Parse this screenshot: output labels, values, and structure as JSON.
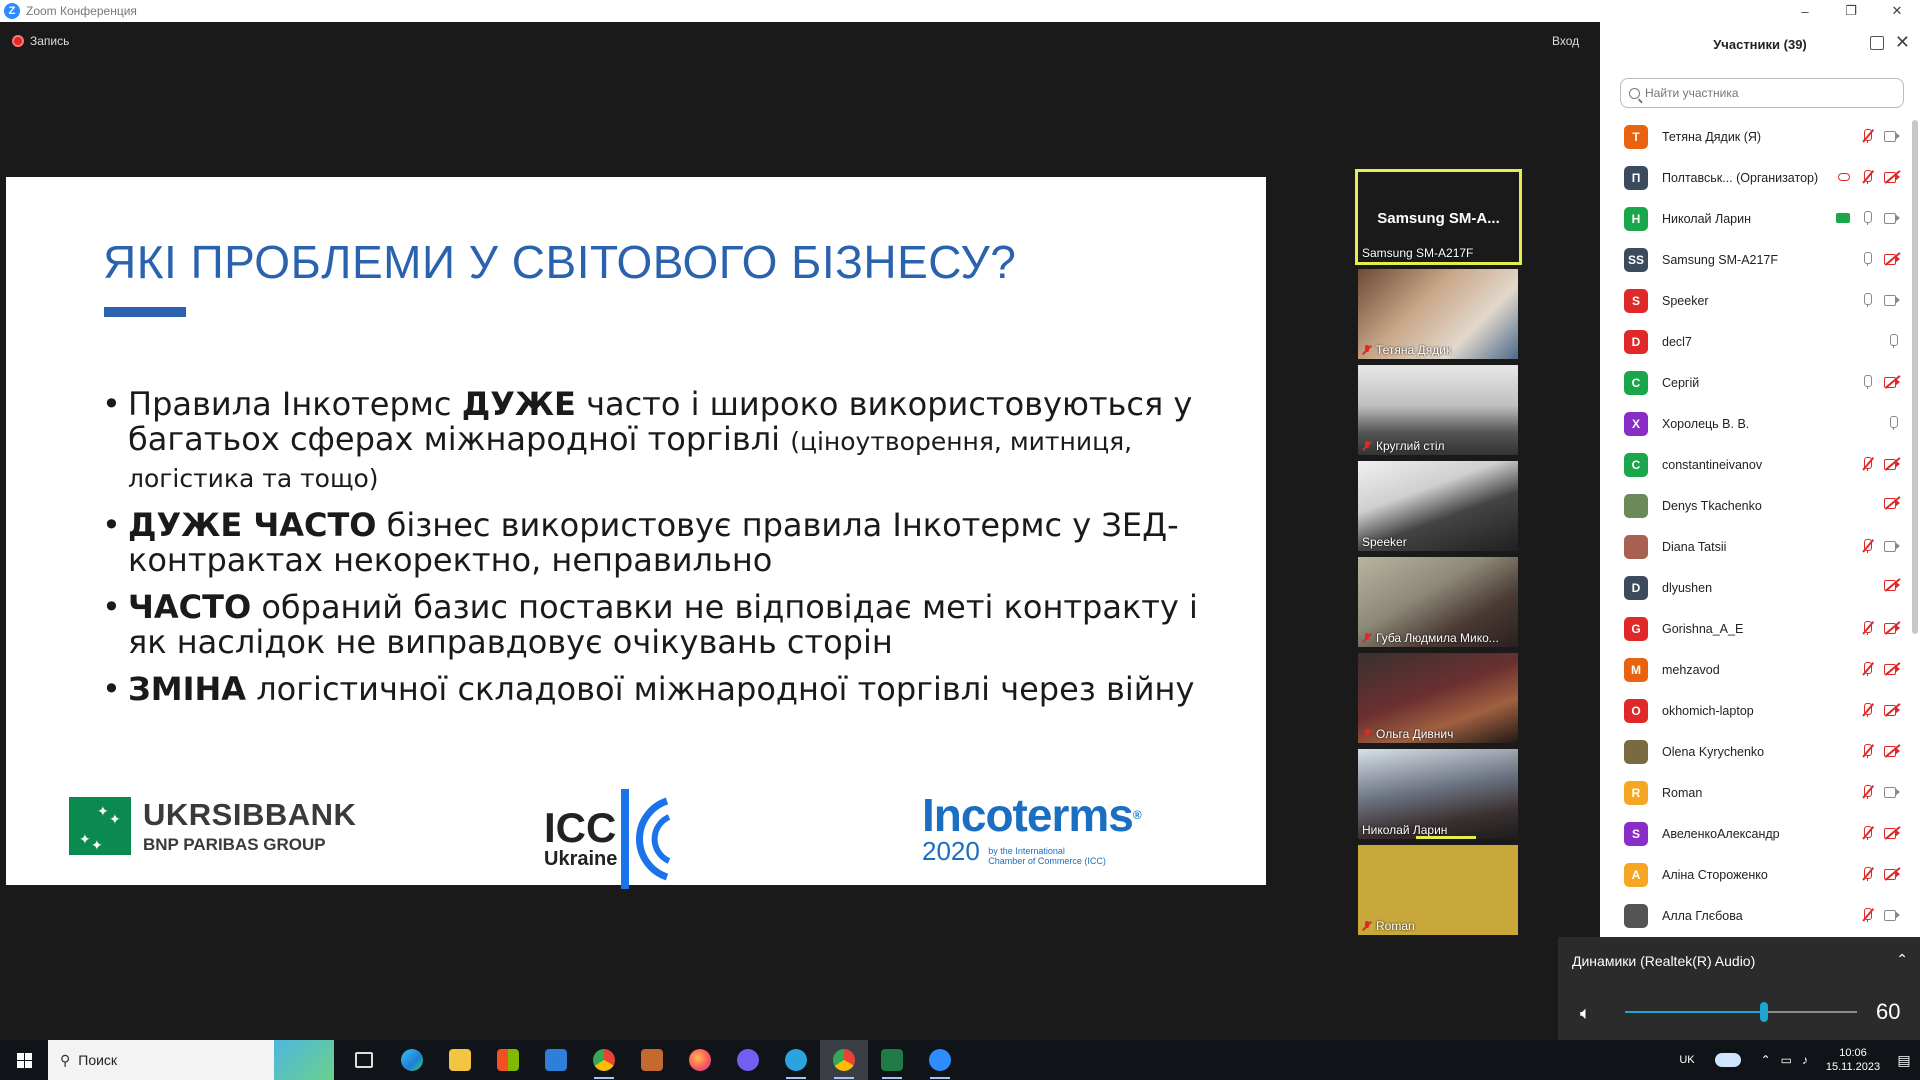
{
  "window": {
    "title": "Zoom Конференция",
    "app_icon": "Z"
  },
  "meeting": {
    "recording_label": "Запись",
    "enter_label": "Вход"
  },
  "slide": {
    "title": "ЯКІ ПРОБЛЕМИ У СВІТОВОГО БІЗНЕСУ?",
    "bullets": [
      {
        "bold": "",
        "pre": "Правила Інкотермс ",
        "strong": "ДУЖЕ",
        "text": " часто і широко використовуються у багатьох сферах міжнародної торгівлі ",
        "small": "(ціноутворення, митниця, логістика та тощо)"
      },
      {
        "strong": "ДУЖЕ ЧАСТО",
        "text": " бізнес використовує правила Інкотермс у ЗЕД-контрактах некоректно, неправильно"
      },
      {
        "strong": "ЧАСТО",
        "text": " обраний базис поставки не відповідає меті контракту і як наслідок не виправдовує очікувань сторін"
      },
      {
        "strong": "ЗМІНА",
        "text": " логістичної складової міжнародної торгівлі через війну"
      }
    ],
    "logos": {
      "ukrsib_name": "UKRSIBBANK",
      "ukrsib_group": "BNP PARIBAS GROUP",
      "icc_name": "ICC",
      "icc_country": "Ukraine",
      "inco_name": "Incoterms",
      "inco_year": "2020",
      "inco_byline_1": "by the International",
      "inco_byline_2": "Chamber of Commerce (ICC)"
    }
  },
  "videos": {
    "active": {
      "center_name": "Samsung  SM-A...",
      "label": "Samsung SM-A217F"
    },
    "tiles": [
      {
        "label": "Тетяна Дядик",
        "muted": true
      },
      {
        "label": "Круглий стіл",
        "muted": true
      },
      {
        "label": "Speeker",
        "muted": false
      },
      {
        "label": "Губа Людмила Мико...",
        "muted": true
      },
      {
        "label": "Ольга Дивнич",
        "muted": true
      },
      {
        "label": "Николай Ларин",
        "muted": false
      },
      {
        "label": "Roman",
        "muted": true
      }
    ]
  },
  "participants": {
    "title": "Участники (39)",
    "search_placeholder": "Найти участника",
    "list": [
      {
        "initial": "Т",
        "name": "Тетяна Дядик (Я)",
        "color": "#e8620f",
        "mic": "off",
        "cam": "on"
      },
      {
        "initial": "П",
        "name": "Полтавськ...  (Организатор)",
        "color": "#3c4a5e",
        "mic": "off",
        "cam": "off",
        "cloud": true
      },
      {
        "initial": "Н",
        "name": "Николай Ларин",
        "color": "#1aa64a",
        "mic": "on",
        "cam": "on",
        "share": true
      },
      {
        "initial": "SS",
        "name": "Samsung SM-A217F",
        "color": "#3c4a5e",
        "mic": "on",
        "cam": "off"
      },
      {
        "initial": "S",
        "name": "Speeker",
        "color": "#e02828",
        "mic": "on",
        "cam": "on"
      },
      {
        "initial": "D",
        "name": "decl7",
        "color": "#e02828",
        "mic": "on",
        "cam": "none"
      },
      {
        "initial": "C",
        "name": "Сергій",
        "color": "#1aa64a",
        "mic": "on",
        "cam": "off"
      },
      {
        "initial": "Х",
        "name": "Хоролець В. В.",
        "color": "#8a2cc6",
        "mic": "on",
        "cam": "none"
      },
      {
        "initial": "C",
        "name": "constantineivanov",
        "color": "#1aa64a",
        "mic": "off",
        "cam": "off"
      },
      {
        "initial": "",
        "name": "Denys Tkachenko",
        "color": "#6b8a5a",
        "mic": "none",
        "cam": "off"
      },
      {
        "initial": "",
        "name": "Diana Tatsii",
        "color": "#a86050",
        "mic": "off",
        "cam": "on"
      },
      {
        "initial": "D",
        "name": "dlyushen",
        "color": "#3c4a5e",
        "mic": "none",
        "cam": "off"
      },
      {
        "initial": "G",
        "name": "Gorishna_A_E",
        "color": "#e02828",
        "mic": "off",
        "cam": "off"
      },
      {
        "initial": "M",
        "name": "mehzavod",
        "color": "#e8620f",
        "mic": "off",
        "cam": "off"
      },
      {
        "initial": "O",
        "name": "okhomich-laptop",
        "color": "#e02828",
        "mic": "off",
        "cam": "off"
      },
      {
        "initial": "",
        "name": "Olena Kyrychenko",
        "color": "#7a6a40",
        "mic": "off",
        "cam": "off"
      },
      {
        "initial": "R",
        "name": "Roman",
        "color": "#f5a623",
        "mic": "off",
        "cam": "on"
      },
      {
        "initial": "S",
        "name": "АвеленкоАлександр",
        "color": "#8a2cc6",
        "mic": "off",
        "cam": "off"
      },
      {
        "initial": "A",
        "name": "Аліна Стороженко",
        "color": "#f5a623",
        "mic": "off",
        "cam": "off"
      },
      {
        "initial": "",
        "name": "Алла Глєбова",
        "color": "#555555",
        "mic": "off",
        "cam": "on"
      }
    ]
  },
  "audio": {
    "device_label": "Динамики (Realtek(R) Audio)",
    "volume": 60,
    "volume_fraction": 0.6,
    "volume_text": "60"
  },
  "taskbar": {
    "search_label": "Поиск",
    "lang": "UK",
    "time": "10:06",
    "date": "15.11.2023"
  }
}
